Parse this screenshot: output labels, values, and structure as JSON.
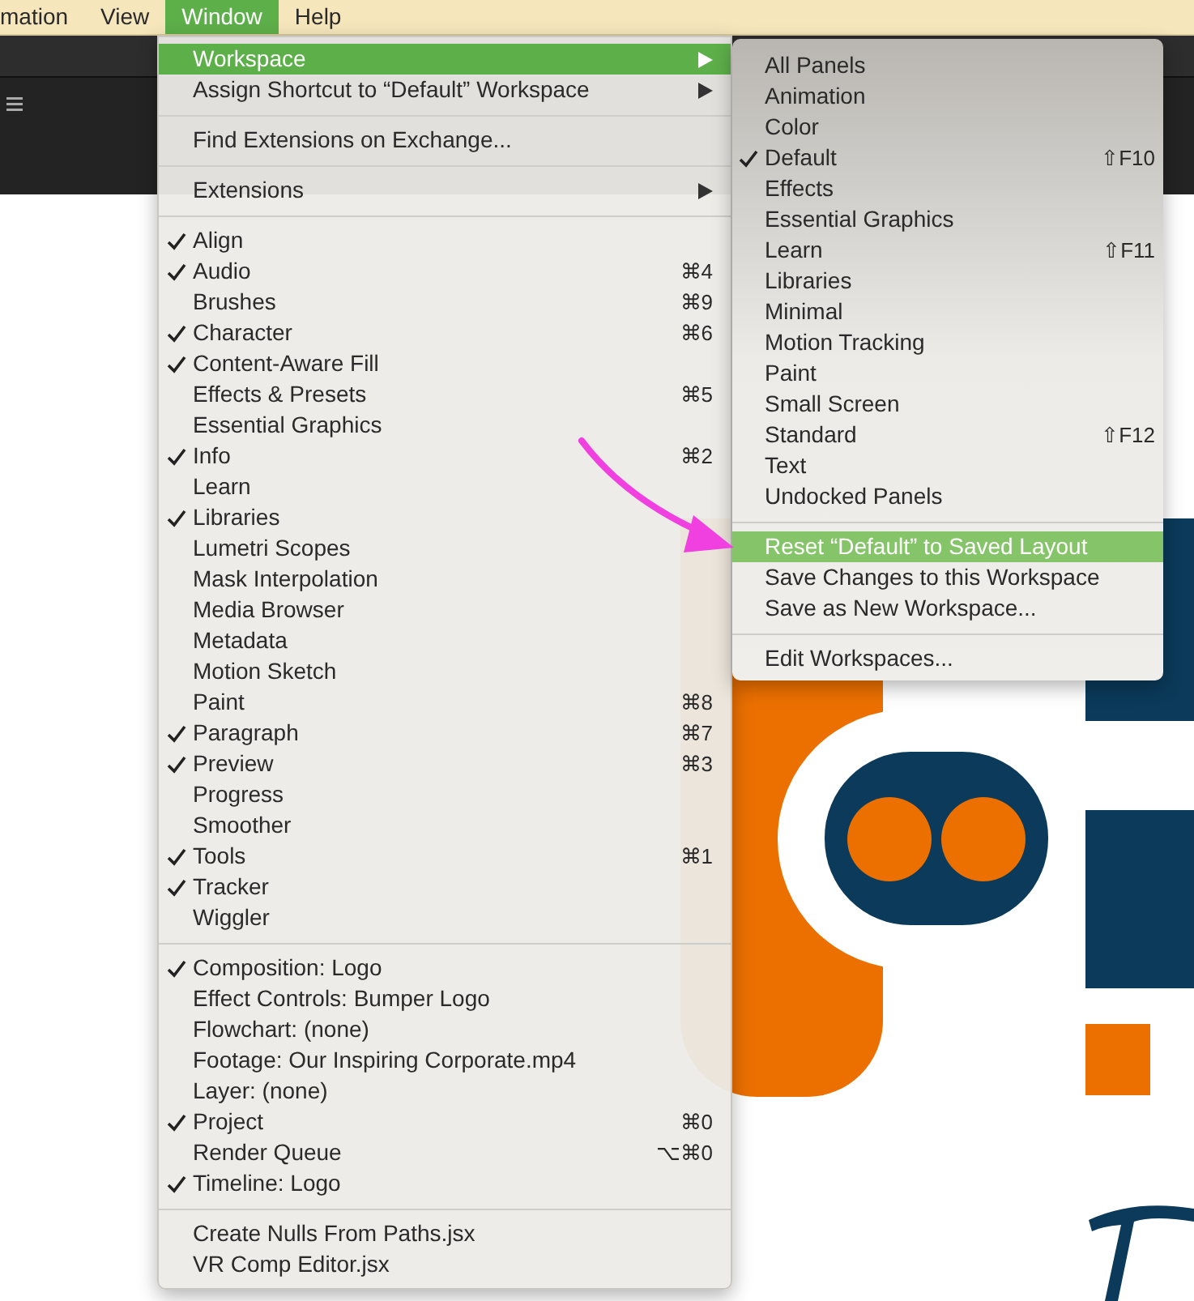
{
  "menu_bar": [
    {
      "label": "mation",
      "selected": false
    },
    {
      "label": "View",
      "selected": false
    },
    {
      "label": "Window",
      "selected": true
    },
    {
      "label": "Help",
      "selected": false
    }
  ],
  "window_menu": {
    "sections": [
      [
        {
          "label": "Workspace",
          "kind": "submenu",
          "checked": false,
          "selected": true
        },
        {
          "label": "Assign Shortcut to “Default” Workspace",
          "kind": "submenu",
          "checked": false,
          "selected": false
        }
      ],
      [
        {
          "label": "Find Extensions on Exchange...",
          "kind": "item",
          "checked": false,
          "selected": false
        }
      ],
      [
        {
          "label": "Extensions",
          "kind": "submenu",
          "checked": false,
          "selected": false
        }
      ],
      [
        {
          "label": "Align",
          "kind": "item",
          "checked": true,
          "selected": false
        },
        {
          "label": "Audio",
          "kind": "item",
          "checked": true,
          "selected": false,
          "shortcut": "⌘4"
        },
        {
          "label": "Brushes",
          "kind": "item",
          "checked": false,
          "selected": false,
          "shortcut": "⌘9"
        },
        {
          "label": "Character",
          "kind": "item",
          "checked": true,
          "selected": false,
          "shortcut": "⌘6"
        },
        {
          "label": "Content-Aware Fill",
          "kind": "item",
          "checked": true,
          "selected": false
        },
        {
          "label": "Effects & Presets",
          "kind": "item",
          "checked": false,
          "selected": false,
          "shortcut": "⌘5"
        },
        {
          "label": "Essential Graphics",
          "kind": "item",
          "checked": false,
          "selected": false
        },
        {
          "label": "Info",
          "kind": "item",
          "checked": true,
          "selected": false,
          "shortcut": "⌘2"
        },
        {
          "label": "Learn",
          "kind": "item",
          "checked": false,
          "selected": false
        },
        {
          "label": "Libraries",
          "kind": "item",
          "checked": true,
          "selected": false
        },
        {
          "label": "Lumetri Scopes",
          "kind": "item",
          "checked": false,
          "selected": false
        },
        {
          "label": "Mask Interpolation",
          "kind": "item",
          "checked": false,
          "selected": false
        },
        {
          "label": "Media Browser",
          "kind": "item",
          "checked": false,
          "selected": false
        },
        {
          "label": "Metadata",
          "kind": "item",
          "checked": false,
          "selected": false
        },
        {
          "label": "Motion Sketch",
          "kind": "item",
          "checked": false,
          "selected": false
        },
        {
          "label": "Paint",
          "kind": "item",
          "checked": false,
          "selected": false,
          "shortcut": "⌘8"
        },
        {
          "label": "Paragraph",
          "kind": "item",
          "checked": true,
          "selected": false,
          "shortcut": "⌘7"
        },
        {
          "label": "Preview",
          "kind": "item",
          "checked": true,
          "selected": false,
          "shortcut": "⌘3"
        },
        {
          "label": "Progress",
          "kind": "item",
          "checked": false,
          "selected": false
        },
        {
          "label": "Smoother",
          "kind": "item",
          "checked": false,
          "selected": false
        },
        {
          "label": "Tools",
          "kind": "item",
          "checked": true,
          "selected": false,
          "shortcut": "⌘1"
        },
        {
          "label": "Tracker",
          "kind": "item",
          "checked": true,
          "selected": false
        },
        {
          "label": "Wiggler",
          "kind": "item",
          "checked": false,
          "selected": false
        }
      ],
      [
        {
          "label": "Composition: Logo",
          "kind": "item",
          "checked": true,
          "selected": false
        },
        {
          "label": "Effect Controls: Bumper Logo",
          "kind": "item",
          "checked": false,
          "selected": false
        },
        {
          "label": "Flowchart: (none)",
          "kind": "item",
          "checked": false,
          "selected": false
        },
        {
          "label": "Footage: Our Inspiring Corporate.mp4",
          "kind": "item",
          "checked": false,
          "selected": false
        },
        {
          "label": "Layer: (none)",
          "kind": "item",
          "checked": false,
          "selected": false
        },
        {
          "label": "Project",
          "kind": "item",
          "checked": true,
          "selected": false,
          "shortcut": "⌘0"
        },
        {
          "label": "Render Queue",
          "kind": "item",
          "checked": false,
          "selected": false,
          "shortcut": "⌥⌘0"
        },
        {
          "label": "Timeline: Logo",
          "kind": "item",
          "checked": true,
          "selected": false
        }
      ],
      [
        {
          "label": "Create Nulls From Paths.jsx",
          "kind": "item",
          "checked": false,
          "selected": false
        },
        {
          "label": "VR Comp Editor.jsx",
          "kind": "item",
          "checked": false,
          "selected": false
        }
      ]
    ]
  },
  "workspace_submenu": {
    "sections": [
      [
        {
          "label": "All Panels",
          "checked": false,
          "selected": false
        },
        {
          "label": "Animation",
          "checked": false,
          "selected": false
        },
        {
          "label": "Color",
          "checked": false,
          "selected": false
        },
        {
          "label": "Default",
          "checked": true,
          "selected": false,
          "shortcut": "⇧F10"
        },
        {
          "label": "Effects",
          "checked": false,
          "selected": false
        },
        {
          "label": "Essential Graphics",
          "checked": false,
          "selected": false
        },
        {
          "label": "Learn",
          "checked": false,
          "selected": false,
          "shortcut": "⇧F11"
        },
        {
          "label": "Libraries",
          "checked": false,
          "selected": false
        },
        {
          "label": "Minimal",
          "checked": false,
          "selected": false
        },
        {
          "label": "Motion Tracking",
          "checked": false,
          "selected": false
        },
        {
          "label": "Paint",
          "checked": false,
          "selected": false
        },
        {
          "label": "Small Screen",
          "checked": false,
          "selected": false
        },
        {
          "label": "Standard",
          "checked": false,
          "selected": false,
          "shortcut": "⇧F12"
        },
        {
          "label": "Text",
          "checked": false,
          "selected": false
        },
        {
          "label": "Undocked Panels",
          "checked": false,
          "selected": false
        }
      ],
      [
        {
          "label": "Reset “Default” to Saved Layout",
          "checked": false,
          "selected": true
        },
        {
          "label": "Save Changes to this Workspace",
          "checked": false,
          "selected": false
        },
        {
          "label": "Save as New Workspace...",
          "checked": false,
          "selected": false
        }
      ],
      [
        {
          "label": "Edit Workspaces...",
          "checked": false,
          "selected": false
        }
      ]
    ]
  }
}
